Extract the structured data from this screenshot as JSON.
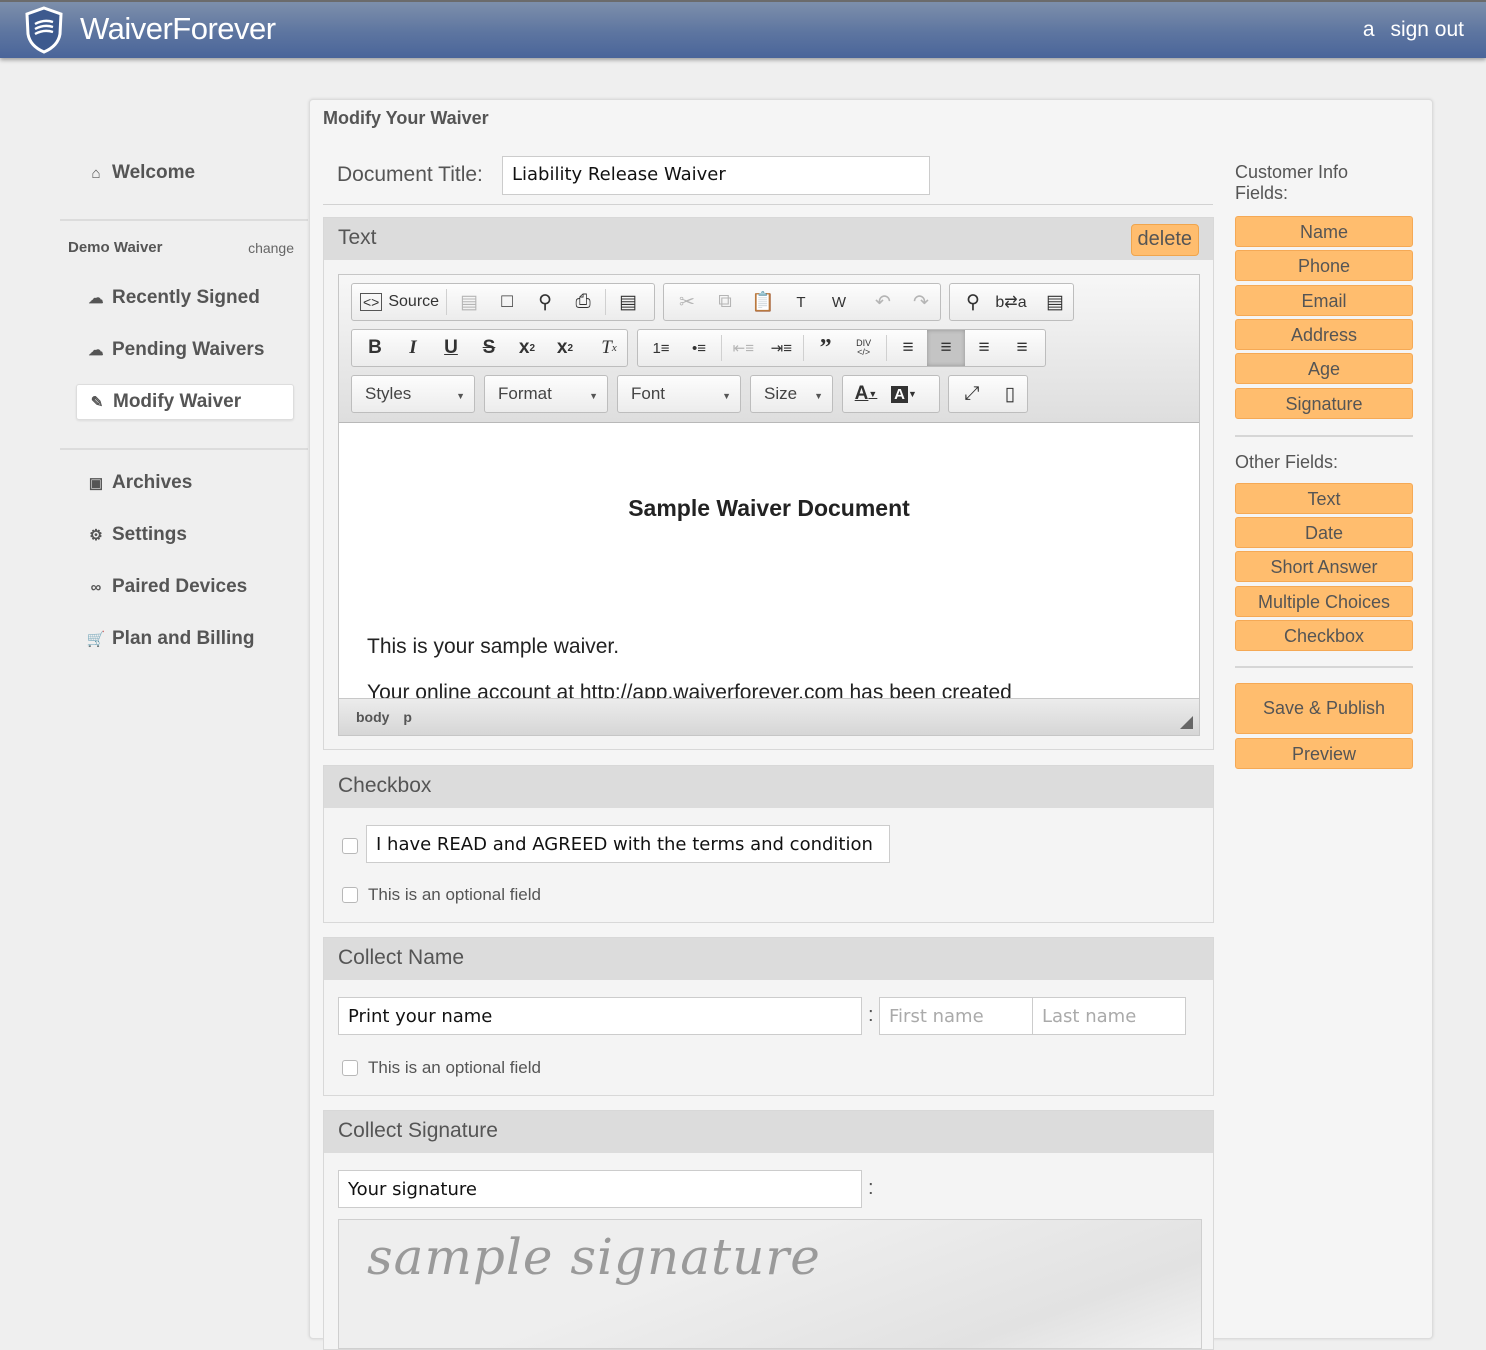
{
  "header": {
    "brand": "WaiverForever",
    "user_initial": "a",
    "sign_out_label": "sign out",
    "bar_color": "#5d75a0"
  },
  "sidebar": {
    "welcome": {
      "label": "Welcome",
      "icon": "home-icon"
    },
    "waiver_name": "Demo Waiver",
    "change_label": "change",
    "waiver_items": [
      {
        "label": "Recently Signed",
        "icon": "cloud-icon"
      },
      {
        "label": "Pending Waivers",
        "icon": "cloud-upload-icon"
      },
      {
        "label": "Modify Waiver",
        "icon": "edit-icon",
        "active": true
      }
    ],
    "account_items": [
      {
        "label": "Archives",
        "icon": "briefcase-icon"
      },
      {
        "label": "Settings",
        "icon": "gear-icon"
      },
      {
        "label": "Paired Devices",
        "icon": "link-icon"
      },
      {
        "label": "Plan and Billing",
        "icon": "cart-icon"
      }
    ]
  },
  "main": {
    "title": "Modify Your Waiver",
    "doc_title_label": "Document Title:",
    "doc_title_value": "Liability Release Waiver",
    "text_block": {
      "heading": "Text",
      "delete_label": "delete",
      "toolbar": {
        "source_label": "Source",
        "combos": [
          "Styles",
          "Format",
          "Font",
          "Size"
        ]
      },
      "document_heading": "Sample Waiver Document",
      "paragraph_1": "This is your sample waiver.",
      "paragraph_2": "Your online account at http://app.waiverforever.com has been created",
      "status_path": [
        "body",
        "p"
      ]
    },
    "checkbox_block": {
      "heading": "Checkbox",
      "statement": "I have READ and AGREED with the terms and condition",
      "optional_label": "This is an optional field"
    },
    "name_block": {
      "heading": "Collect Name",
      "label_value": "Print your name",
      "first_placeholder": "First name",
      "last_placeholder": "Last name",
      "optional_label": "This is an optional field"
    },
    "signature_block": {
      "heading": "Collect Signature",
      "label_value": "Your signature",
      "sample_text": "sample signature"
    }
  },
  "right": {
    "customer_label": "Customer Info Fields:",
    "customer_fields": [
      "Name",
      "Phone",
      "Email",
      "Address",
      "Age",
      "Signature"
    ],
    "other_label": "Other Fields:",
    "other_fields": [
      "Text",
      "Date",
      "Short Answer",
      "Multiple Choices",
      "Checkbox"
    ],
    "save_label": "Save & Publish",
    "preview_label": "Preview",
    "button_color": "#ffbd6e"
  }
}
